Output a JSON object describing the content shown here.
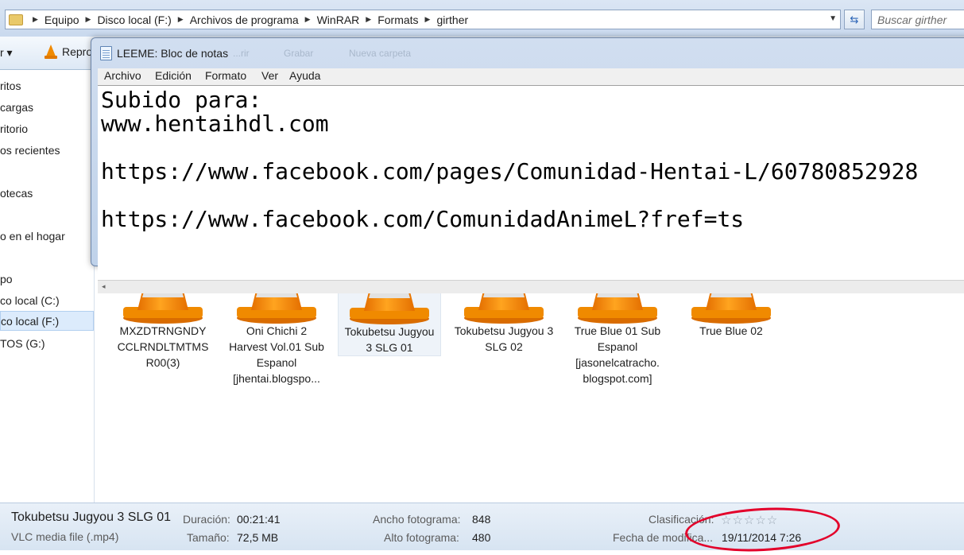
{
  "explorer": {
    "breadcrumb": [
      "Equipo",
      "Disco local (F:)",
      "Archivos de programa",
      "WinRAR",
      "Formats",
      "girther"
    ],
    "search_placeholder": "Buscar girther",
    "toolbar": {
      "organize_label": "r ▾",
      "play_label": "Repro"
    },
    "nav_items": [
      {
        "label": "ritos"
      },
      {
        "label": "cargas"
      },
      {
        "label": "ritorio"
      },
      {
        "label": "os recientes"
      },
      {
        "label": "otecas"
      },
      {
        "label": "o en el hogar"
      },
      {
        "label": "po"
      },
      {
        "label": "co local (C:)"
      },
      {
        "label": "co local (F:)"
      },
      {
        "label": "TOS (G:)"
      }
    ],
    "files": [
      {
        "name": "MXZDTRNGNDY CCLRNDLTMTMS R00(3)"
      },
      {
        "name": "Oni Chichi 2 Harvest Vol.01 Sub Espanol [jhentai.blogspo..."
      },
      {
        "name": "Tokubetsu Jugyou 3 SLG 01"
      },
      {
        "name": "Tokubetsu Jugyou 3 SLG 02"
      },
      {
        "name": "True Blue 01 Sub Espanol [jasonelcatracho. blogspot.com]"
      },
      {
        "name": "True Blue 02"
      }
    ],
    "details": {
      "file_name": "Tokubetsu Jugyou 3 SLG 01",
      "file_type": "VLC media file (.mp4)",
      "duration_label": "Duración:",
      "duration": "00:21:41",
      "size_label": "Tamaño:",
      "size": "72,5 MB",
      "frame_width_label": "Ancho fotograma:",
      "frame_width": "848",
      "frame_height_label": "Alto fotograma:",
      "frame_height": "480",
      "rating_label": "Clasificación:",
      "rating_stars": 0,
      "rating_display": "☆☆☆☆☆",
      "modified_label": "Fecha de modifica...",
      "modified": "19/11/2014 7:26",
      "annotation_color": "#e3002a"
    }
  },
  "notepad": {
    "title": "LEEME: Bloc de notas",
    "ghost_menu": [
      "...rir",
      "Grabar",
      "Nueva carpeta"
    ],
    "menu": [
      "Archivo",
      "Edición",
      "Formato",
      "Ver",
      "Ayuda"
    ],
    "lines": [
      "Subido para:",
      "www.hentaihdl.com",
      "",
      "https://www.facebook.com/pages/Comunidad-Hentai-L/60780852928",
      "",
      "https://www.facebook.com/ComunidadAnimeL?fref=ts"
    ],
    "scroll_left_glyph": "◂"
  },
  "colors": {
    "vlc_cone_orange": "#f08a00",
    "selection_fill": "#dcebfc"
  }
}
